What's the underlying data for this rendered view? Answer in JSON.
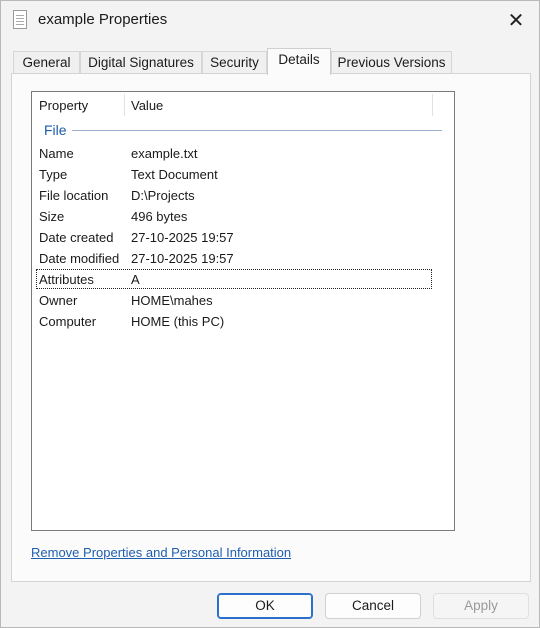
{
  "window": {
    "title": "example Properties",
    "close_symbol": "✕"
  },
  "tabs": [
    {
      "label": "General"
    },
    {
      "label": "Digital Signatures"
    },
    {
      "label": "Security"
    },
    {
      "label": "Details",
      "active": true
    },
    {
      "label": "Previous Versions"
    }
  ],
  "details": {
    "columns": {
      "property": "Property",
      "value": "Value"
    },
    "group_label": "File",
    "rows": [
      {
        "property": "Name",
        "value": "example.txt"
      },
      {
        "property": "Type",
        "value": "Text Document"
      },
      {
        "property": "File location",
        "value": "D:\\Projects"
      },
      {
        "property": "Size",
        "value": "496 bytes"
      },
      {
        "property": "Date created",
        "value": "27-10-2025 19:57"
      },
      {
        "property": "Date modified",
        "value": "27-10-2025 19:57"
      },
      {
        "property": "Attributes",
        "value": "A",
        "focused": true
      },
      {
        "property": "Owner",
        "value": "HOME\\mahes"
      },
      {
        "property": "Computer",
        "value": "HOME (this PC)"
      }
    ]
  },
  "remove_link": "Remove Properties and Personal Information",
  "buttons": {
    "ok": "OK",
    "cancel": "Cancel",
    "apply": "Apply",
    "apply_disabled": true
  },
  "colors": {
    "accent": "#2a6fc9",
    "link": "#1f5fb0",
    "group_header": "#1e5aa8"
  },
  "icons": {
    "title": "text-file-icon",
    "close": "close-icon"
  }
}
